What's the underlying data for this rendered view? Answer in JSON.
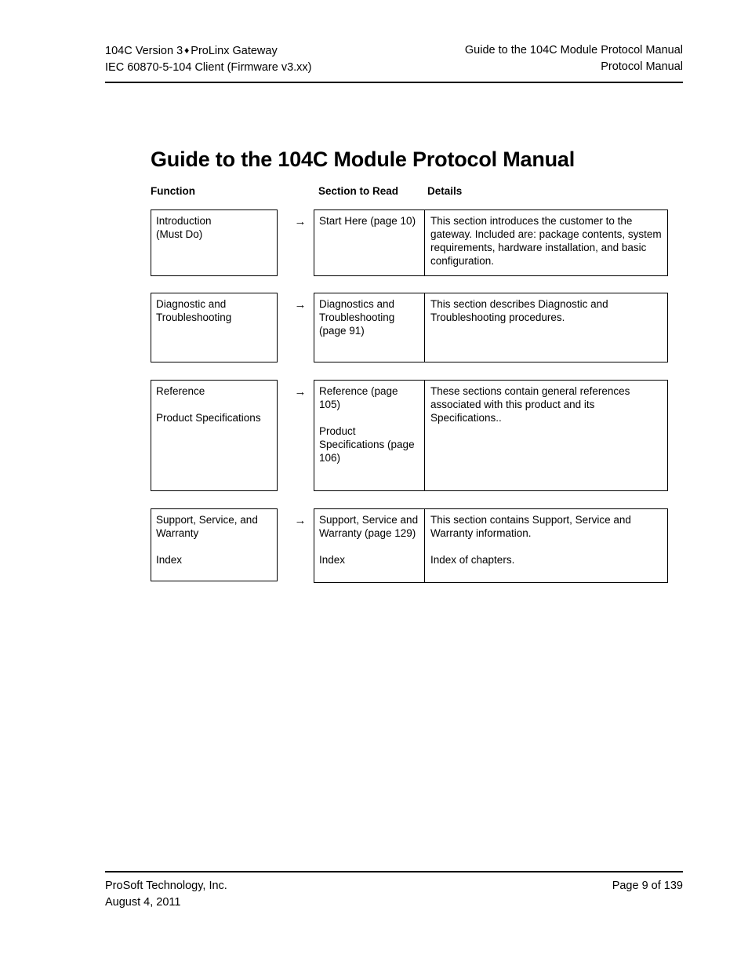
{
  "header": {
    "left_line_1_pre": "104C Version 3",
    "separator_icon": "♦",
    "left_line_1_post": "ProLinx Gateway",
    "left_line_2": "IEC 60870-5-104 Client (Firmware v3.xx)",
    "right_line_1": "Guide to the 104C Module Protocol Manual",
    "right_line_2": "Protocol Manual"
  },
  "title": "Guide to the 104C Module Protocol Manual",
  "table": {
    "columns": {
      "function": "Function",
      "section": "Section to Read",
      "details": "Details"
    },
    "arrow_icon": "→",
    "rows": [
      {
        "function_line_1": "Introduction",
        "function_line_2": "(Must Do)",
        "section_line_1": "Start Here (page 10)",
        "section_line_2": "",
        "details_line_1": "This section introduces the customer to the gateway. Included are: package contents, system requirements, hardware installation, and basic configuration.",
        "details_line_2": ""
      },
      {
        "function_line_1": "Diagnostic and Troubleshooting",
        "function_line_2": "",
        "section_line_1": "Diagnostics and Troubleshooting (page 91)",
        "section_line_2": "",
        "details_line_1": "This section describes Diagnostic and Troubleshooting procedures.",
        "details_line_2": ""
      },
      {
        "function_line_1": "Reference",
        "function_line_2": "Product Specifications",
        "section_line_1": "Reference (page 105)",
        "section_line_2": "Product Specifications (page 106)",
        "details_line_1": "These sections contain general references associated with this product and its Specifications..",
        "details_line_2": ""
      },
      {
        "function_line_1": "Support, Service, and Warranty",
        "function_line_2": "Index",
        "section_line_1": "Support, Service and Warranty (page 129)",
        "section_line_2": "Index",
        "details_line_1": "This section contains Support, Service and Warranty information.",
        "details_line_2": "Index of chapters."
      }
    ]
  },
  "footer": {
    "left_line_1": "ProSoft Technology, Inc.",
    "left_line_2": "August 4, 2011",
    "right_line_1": "Page 9 of 139"
  }
}
